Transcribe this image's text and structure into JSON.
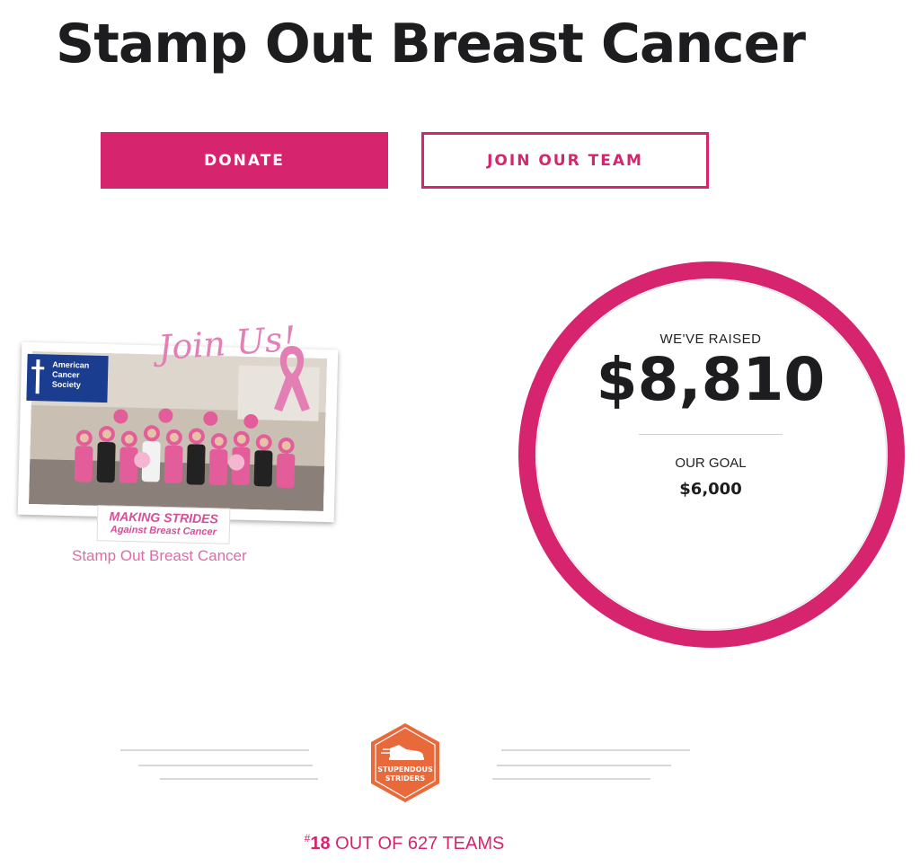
{
  "page": {
    "title": "Stamp Out Breast Cancer"
  },
  "actions": {
    "donate_label": "DONATE",
    "join_label": "JOIN OUR TEAM"
  },
  "photo": {
    "logo_text": "American Cancer Society",
    "overlay_text": "Join Us!",
    "banner_line1": "MAKING STRIDES",
    "banner_line2": "Against Breast Cancer",
    "caption": "Stamp Out Breast Cancer"
  },
  "progress": {
    "raised_label": "WE'VE RAISED",
    "raised_amount": "$8,810",
    "goal_label": "OUR GOAL",
    "goal_amount": "$6,000"
  },
  "badge": {
    "line1": "STUPENDOUS",
    "line2": "STRIDERS",
    "icon": "shoe-icon"
  },
  "rank": {
    "hash": "#",
    "position": "18",
    "suffix": "OUT OF 627 TEAMS"
  },
  "colors": {
    "brand": "#d6246f",
    "badge": "#e8693a",
    "text": "#1d1d1f"
  }
}
